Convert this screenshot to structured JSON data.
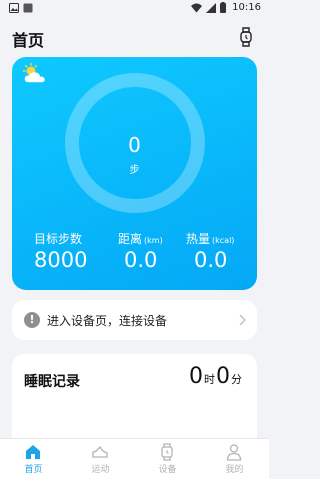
{
  "status_bar": {
    "time": "10:16",
    "left_icons": [
      "image-icon",
      "square-icon"
    ],
    "right_icons": [
      "wifi-icon",
      "signal-icon",
      "battery-icon"
    ]
  },
  "header": {
    "title": "首页",
    "action_icon": "watch-icon"
  },
  "activity": {
    "steps_value": "0",
    "steps_unit": "步",
    "progress": 0,
    "weather_icon": "partly-sunny-icon",
    "stats": [
      {
        "label": "目标步数",
        "unit": "",
        "value": "8000"
      },
      {
        "label": "距离",
        "unit": "(km)",
        "value": "0.0"
      },
      {
        "label": "热量",
        "unit": "(kcal)",
        "value": "0.0"
      }
    ]
  },
  "device_prompt": {
    "text": "进入设备页，连接设备",
    "icon": "info-icon"
  },
  "sleep": {
    "title": "睡眠记录",
    "hours": "0",
    "hours_unit": "时",
    "minutes": "0",
    "minutes_unit": "分"
  },
  "tabs": [
    {
      "label": "首页",
      "icon": "home-icon",
      "active": true
    },
    {
      "label": "运动",
      "icon": "shoe-icon",
      "active": false
    },
    {
      "label": "设备",
      "icon": "watch-icon",
      "active": false
    },
    {
      "label": "我的",
      "icon": "person-icon",
      "active": false
    }
  ],
  "colors": {
    "card_gradient_start": "#0fc9ff",
    "card_gradient_end": "#04a8f5",
    "active_tab": "#1fa4e8",
    "inactive_tab": "#b3b3b3"
  }
}
